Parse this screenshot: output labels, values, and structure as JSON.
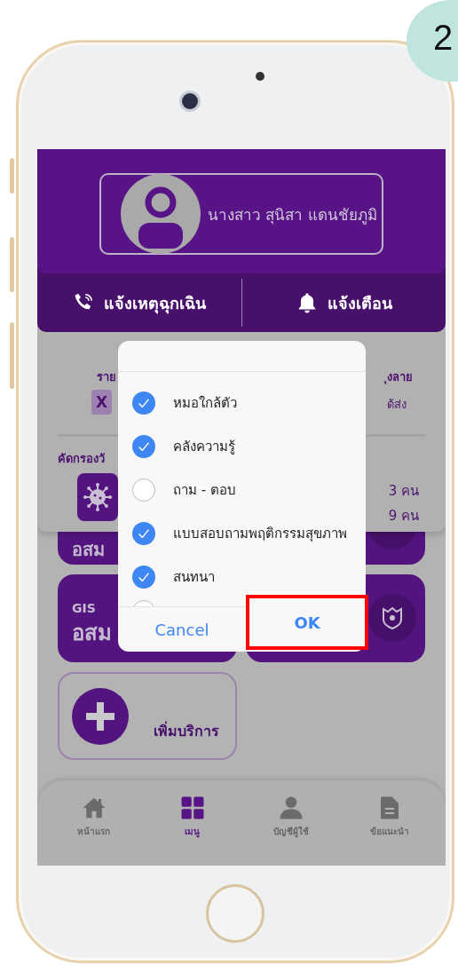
{
  "step_badge": "2",
  "profile": {
    "name": "นางสาว สุนิสา แดนชัยภูมิ"
  },
  "actions": [
    {
      "label": "แจ้งเหตุฉุกเฉิน"
    },
    {
      "label": "แจ้งเตือน"
    }
  ],
  "summary": {
    "left_label": "ราย",
    "left_badge": "X",
    "right_label": "ุงลาย",
    "right_value": "ด้ส่ง",
    "section_title": "คัดกรองวั",
    "counts": [
      "3 คน",
      "9 คน"
    ]
  },
  "services": [
    {
      "kind": "partial",
      "title": "อสม"
    },
    {
      "kind": "partial-icon"
    },
    {
      "kind": "titled",
      "subtitle": "GIS",
      "title": "อสม"
    },
    {
      "kind": "icon"
    },
    {
      "kind": "add",
      "title": "เพิ่มบริการ"
    }
  ],
  "dialog": {
    "items": [
      {
        "label": "หมอใกล้ตัว",
        "checked": true
      },
      {
        "label": "คลังความรู้",
        "checked": true
      },
      {
        "label": "ถาม - ตอบ",
        "checked": false
      },
      {
        "label": "แบบสอบถามพฤติกรรมสุขภาพ",
        "checked": true
      },
      {
        "label": "สนทนา",
        "checked": true
      }
    ],
    "partial_item": {
      "checked": false
    },
    "buttons": [
      {
        "label": "Cancel",
        "highlighted": false
      },
      {
        "label": "OK",
        "highlighted": true
      }
    ]
  },
  "nav": [
    {
      "label": "หน้าแรก",
      "selected": false
    },
    {
      "label": "เมนู",
      "selected": true
    },
    {
      "label": "บัญชีผู้ใช้",
      "selected": false
    },
    {
      "label": "ข้อแนะนำ",
      "selected": false
    }
  ]
}
